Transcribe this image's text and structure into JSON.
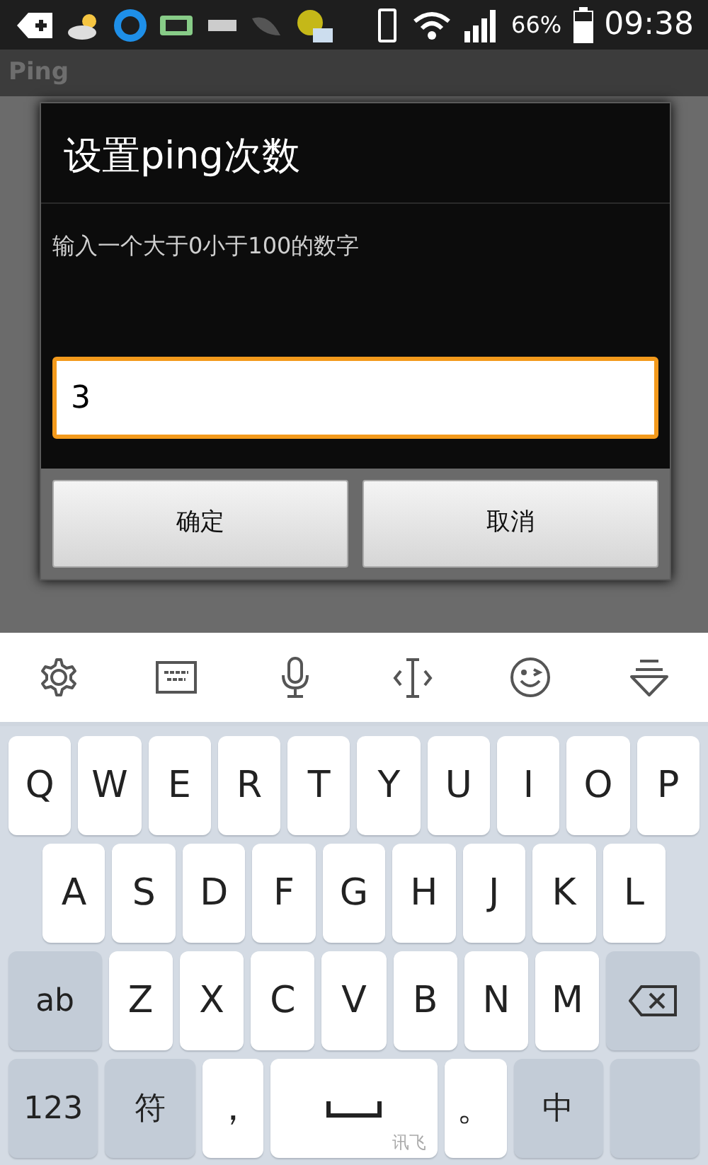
{
  "status_bar": {
    "battery": "66%",
    "time": "09:38"
  },
  "app_bar": {
    "title": "Ping"
  },
  "dialog": {
    "title": "设置ping次数",
    "message": "输入一个大于0小于100的数字",
    "input": {
      "value": "3",
      "focused": true
    },
    "buttons": [
      "确定",
      "取消"
    ]
  },
  "keyboard": {
    "rows": [
      [
        {
          "label": "Q",
          "kind": "letter"
        },
        {
          "label": "W",
          "kind": "letter"
        },
        {
          "label": "E",
          "kind": "letter"
        },
        {
          "label": "R",
          "kind": "letter"
        },
        {
          "label": "T",
          "kind": "letter"
        },
        {
          "label": "Y",
          "kind": "letter"
        },
        {
          "label": "U",
          "kind": "letter"
        },
        {
          "label": "I",
          "kind": "letter"
        },
        {
          "label": "O",
          "kind": "letter"
        },
        {
          "label": "P",
          "kind": "letter"
        }
      ],
      [
        {
          "label": "A",
          "kind": "letter"
        },
        {
          "label": "S",
          "kind": "letter"
        },
        {
          "label": "D",
          "kind": "letter"
        },
        {
          "label": "F",
          "kind": "letter"
        },
        {
          "label": "G",
          "kind": "letter"
        },
        {
          "label": "H",
          "kind": "letter"
        },
        {
          "label": "J",
          "kind": "letter"
        },
        {
          "label": "K",
          "kind": "letter"
        },
        {
          "label": "L",
          "kind": "letter"
        }
      ],
      [
        {
          "label": "ab",
          "kind": "function"
        },
        {
          "label": "Z",
          "kind": "letter"
        },
        {
          "label": "X",
          "kind": "letter"
        },
        {
          "label": "C",
          "kind": "letter"
        },
        {
          "label": "V",
          "kind": "letter"
        },
        {
          "label": "B",
          "kind": "letter"
        },
        {
          "label": "N",
          "kind": "letter"
        },
        {
          "label": "M",
          "kind": "letter"
        },
        {
          "kind": "backspace"
        }
      ],
      [
        {
          "label": "123",
          "kind": "function"
        },
        {
          "label": "符",
          "kind": "function"
        },
        {
          "label": "，",
          "kind": "letter"
        },
        {
          "kind": "space",
          "sublabel": "讯飞"
        },
        {
          "label": "。",
          "kind": "letter"
        },
        {
          "label": "中",
          "kind": "function"
        },
        {
          "kind": "enter"
        }
      ]
    ]
  }
}
